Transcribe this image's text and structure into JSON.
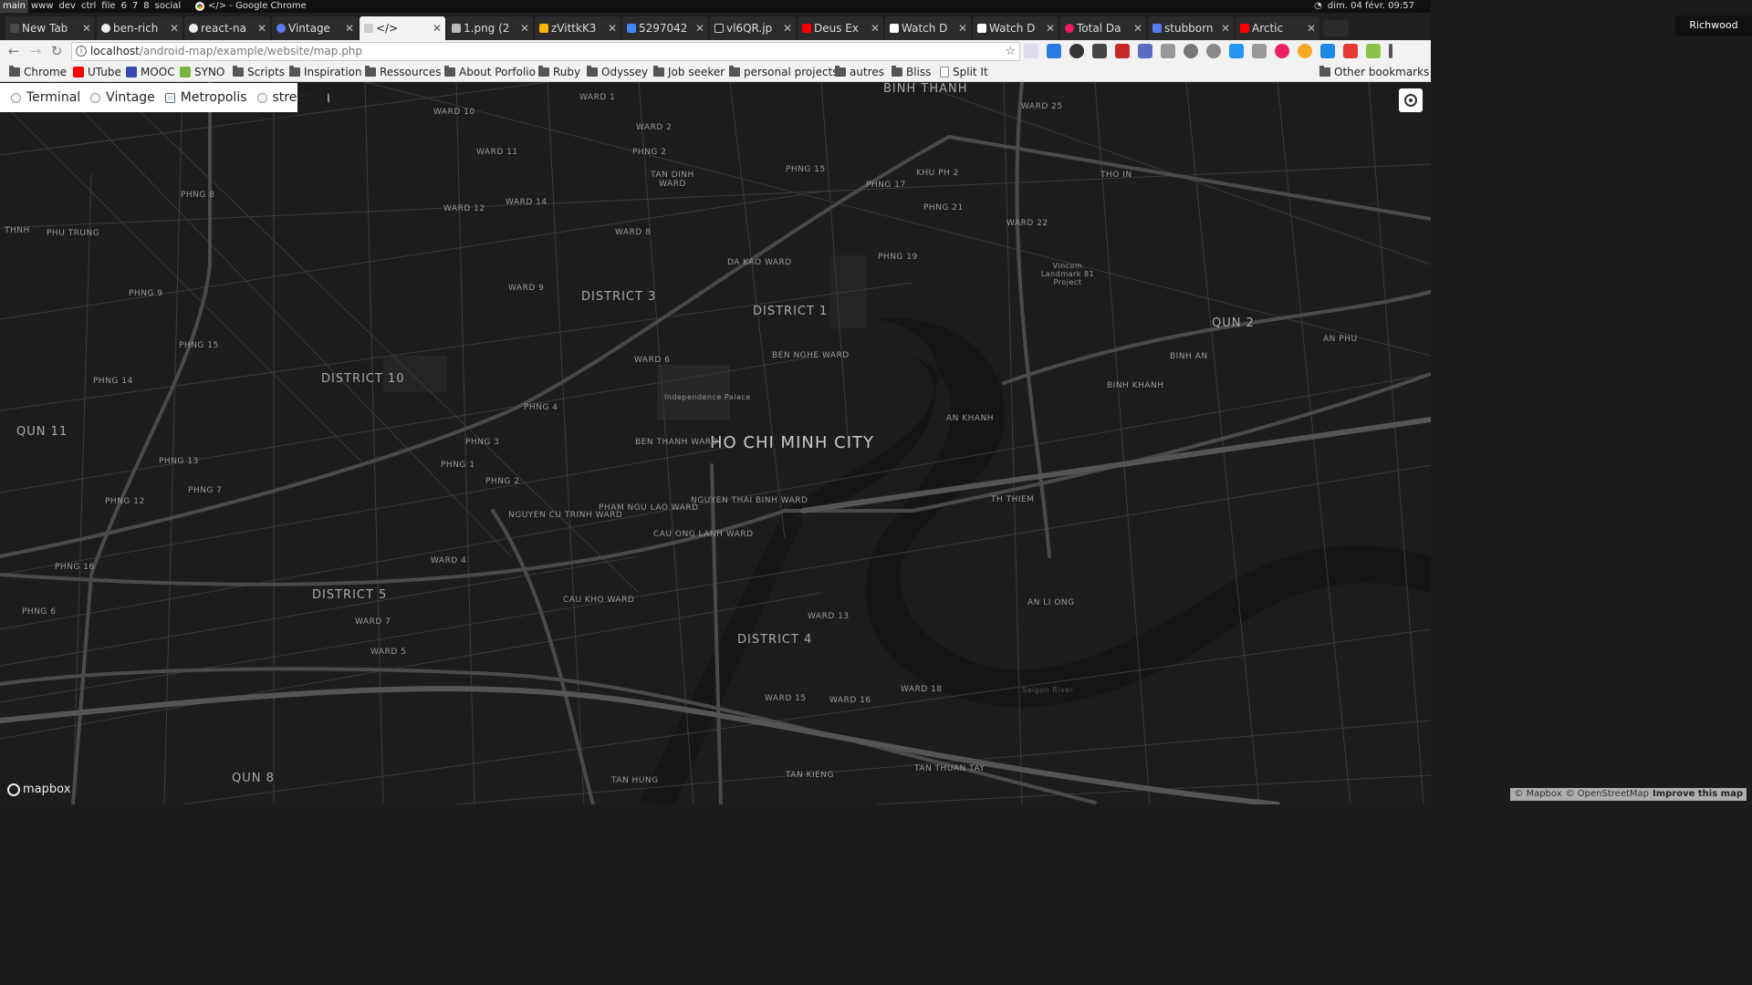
{
  "system_bar": {
    "workspaces": [
      "main",
      "www",
      "dev",
      "ctrl",
      "file",
      "6",
      "7",
      "8",
      "social"
    ],
    "active_workspace": "main",
    "window_title": "</> - Google Chrome",
    "datetime": "dim. 04 févr. 09:57"
  },
  "tabs": [
    {
      "label": "New Tab",
      "color": "#4a4a4a"
    },
    {
      "label": "ben-rich",
      "color": "#ffffff"
    },
    {
      "label": "react-na",
      "color": "#ffffff"
    },
    {
      "label": "Vintage",
      "color": "#5b7cf2"
    },
    {
      "label": "</>",
      "color": "#cccccc",
      "active": true
    },
    {
      "label": "1.png (2",
      "color": "#bbbbbb"
    },
    {
      "label": "zVittkK3",
      "color": "#f4b400"
    },
    {
      "label": "5297042",
      "color": "#4285f4"
    },
    {
      "label": "vl6QR.jp",
      "color": "#222222"
    },
    {
      "label": "Deus Ex",
      "color": "#ff0000"
    },
    {
      "label": "Watch D",
      "color": "#ffffff"
    },
    {
      "label": "Watch D",
      "color": "#ffffff"
    },
    {
      "label": "Total Da",
      "color": "#e91e63"
    },
    {
      "label": "stubborn",
      "color": "#5b7cf2"
    },
    {
      "label": "Arctic",
      "color": "#ff0000"
    }
  ],
  "profile": "Richwood",
  "omnibox": {
    "host": "localhost",
    "path": "/android-map/example/website/map.php"
  },
  "bookmarks": [
    {
      "label": "Chrome",
      "icon": "folder"
    },
    {
      "label": "UTube",
      "icon": "youtube"
    },
    {
      "label": "MOOC",
      "icon": "mooc"
    },
    {
      "label": "SYNO",
      "icon": "syno"
    },
    {
      "label": "Scripts",
      "icon": "folder"
    },
    {
      "label": "Inspiration",
      "icon": "folder"
    },
    {
      "label": "Ressources",
      "icon": "folder"
    },
    {
      "label": "About Porfolio",
      "icon": "folder"
    },
    {
      "label": "Ruby",
      "icon": "folder"
    },
    {
      "label": "Odyssey",
      "icon": "folder"
    },
    {
      "label": "Job seeker",
      "icon": "folder"
    },
    {
      "label": "personal projects",
      "icon": "folder"
    },
    {
      "label": "autres",
      "icon": "folder"
    },
    {
      "label": "Bliss",
      "icon": "folder"
    },
    {
      "label": "Split It",
      "icon": "page"
    }
  ],
  "other_bookmarks": "Other bookmarks",
  "layer_switcher": [
    {
      "label": "Terminal",
      "selected": false
    },
    {
      "label": "Vintage",
      "selected": false
    },
    {
      "label": "Metropolis",
      "selected": true
    },
    {
      "label": "streets",
      "selected": false
    }
  ],
  "map": {
    "city": "HO CHI MINH CITY",
    "districts": [
      "DISTRICT 3",
      "DISTRICT 1",
      "DISTRICT 10",
      "DISTRICT 5",
      "DISTRICT 4",
      "QUN 2",
      "QUN 11",
      "QUN 8",
      "BINH THANH"
    ],
    "wards": [
      "WARD 1",
      "WARD 2",
      "Phng 2",
      "WARD 10",
      "WARD 11",
      "WARD 14",
      "WARD 12",
      "WARD 8",
      "DA KAO WARD",
      "PHNG 15",
      "PHNG 17",
      "Khu Ph 2",
      "PHNG 21",
      "WARD 22",
      "WARD 25",
      "THO IN",
      "PHNG 19",
      "BEN NGHE WARD",
      "WARD 6",
      "WARD 9",
      "PHNG 4",
      "PHNG 3",
      "PHNG 1",
      "PHNG 2",
      "BEN THANH WARD",
      "NGUYEN THAI BINH WARD",
      "NGUYEN CU TRINH WARD",
      "PHAM NGU LAO WARD",
      "CAU ONG LANH WARD",
      "CAU KHO WARD",
      "AN KHANH",
      "BINH AN",
      "BINH KHANH",
      "AN PHU",
      "TH THIEM",
      "AN LI ONG",
      "PHNG 8",
      "PHNG 9",
      "PHNG 6",
      "PHNG 14",
      "PHNG 15",
      "PHNG 13",
      "PHNG 12",
      "PHNG 16",
      "PHNG 7",
      "WARD 13",
      "WARD 15",
      "WARD 16",
      "WARD 18",
      "TAN KIENG",
      "TAN HUNG",
      "TAN THUAN TAY",
      "PHU TRUNG",
      "THNH",
      "Independence Palace",
      "Vincom Landmark 81 Project",
      "Saigon River",
      "TAN DINH WARD",
      "WARD 4",
      "WARD 5",
      "WARD 7"
    ],
    "attribution": {
      "mapbox": "© Mapbox",
      "osm": "© OpenStreetMap",
      "improve": "Improve this map"
    },
    "logo": "mapbox"
  }
}
